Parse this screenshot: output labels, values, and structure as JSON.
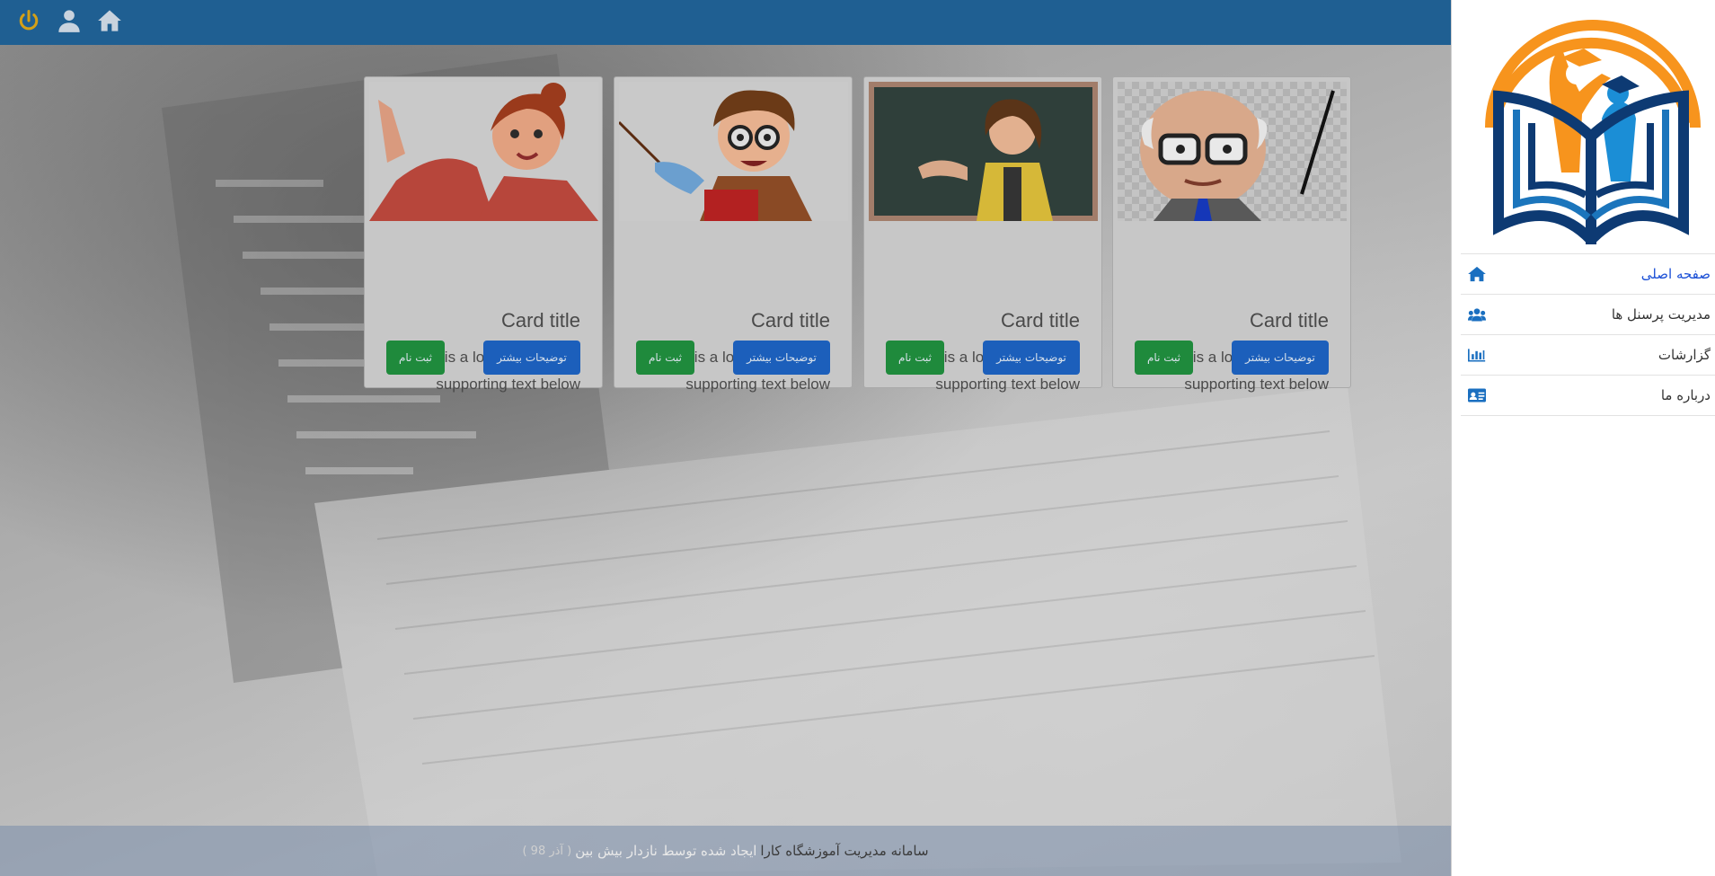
{
  "topbar": {
    "icons": [
      "power-icon",
      "user-icon",
      "home-icon"
    ],
    "color": "#1f5f92"
  },
  "cards": [
    {
      "illustration": "teacher-woman-red-sweater",
      "title": "Card title",
      "text": "This is a longer card with supporting text below",
      "more_label": "توضیحات بیشتر",
      "register_label": "ثبت نام"
    },
    {
      "illustration": "teacher-boy-glasses-pointer",
      "title": "Card title",
      "text": "This is a longer card with supporting text below",
      "more_label": "توضیحات بیشتر",
      "register_label": "ثبت نام"
    },
    {
      "illustration": "teacher-woman-blackboard",
      "title": "Card title",
      "text": "This is a longer card with supporting text below",
      "more_label": "توضیحات بیشتر",
      "register_label": "ثبت نام"
    },
    {
      "illustration": "teacher-old-man-pointer",
      "title": "Card title",
      "text": "This is a longer card with supporting text below",
      "more_label": "توضیحات بیشتر",
      "register_label": "ثبت نام"
    }
  ],
  "footer": {
    "system_name": "سامانه مدیریت آموزشگاه کارا",
    "created_by": "ایجاد شده توسط نازدار بیش بین",
    "date": "( آذر 98 )"
  },
  "sidebar": {
    "logo": "school-logo-book-graduates",
    "items": [
      {
        "label": "صفحه اصلی",
        "icon": "home-icon",
        "active": true
      },
      {
        "label": "مدیریت پرسنل ها",
        "icon": "users-icon",
        "active": false
      },
      {
        "label": "گزارشات",
        "icon": "chart-icon",
        "active": false
      },
      {
        "label": "درباره ما",
        "icon": "id-card-icon",
        "active": false
      }
    ]
  },
  "colors": {
    "primary_button": "#1c5fbb",
    "success_button": "#1f8a3c",
    "menu_icon": "#1a6fc0",
    "logo_orange": "#f7941d",
    "logo_blue": "#1b75bc",
    "power_icon": "#d4a017"
  }
}
